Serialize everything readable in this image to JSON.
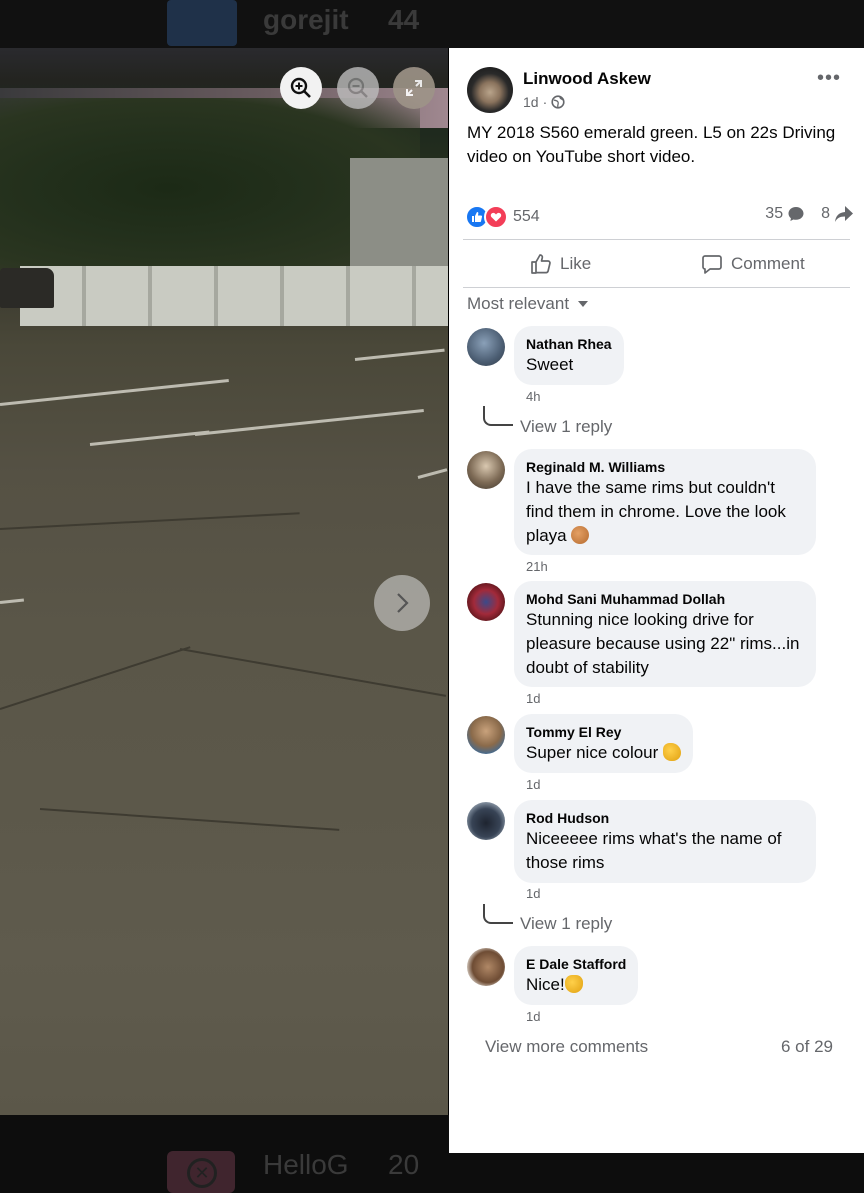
{
  "background": {
    "top_app": {
      "name": "gorejit",
      "count": "44"
    },
    "bottom_app": {
      "name": "HelloG",
      "count": "20"
    }
  },
  "viewer": {
    "icons": [
      "zoom-in-icon",
      "zoom-out-icon",
      "expand-icon",
      "chevron-right-icon"
    ]
  },
  "post": {
    "author": "Linwood Askew",
    "time": "1d",
    "audience_icon": "globe-icon",
    "text": "MY 2018 S560 emerald green. L5 on 22s Driving video on YouTube short video.",
    "reactions_count": "554",
    "comments_count": "35",
    "shares_count": "8",
    "like_label": "Like",
    "comment_label": "Comment",
    "sort_label": "Most relevant"
  },
  "comments": [
    {
      "name": "Nathan Rhea",
      "text": "Sweet",
      "time": "4h",
      "replies": "View 1 reply"
    },
    {
      "name": "Reginald M. Williams",
      "text_lines": [
        "I have the same rims but couldn't",
        "find them in chrome. Love the look",
        "playa"
      ],
      "time": "21h"
    },
    {
      "name": "Mohd Sani Muhammad Dollah",
      "text_lines": [
        "Stunning nice looking drive for",
        "pleasure because using 22\" rims...in",
        "doubt of stability"
      ],
      "time": "1d"
    },
    {
      "name": "Tommy El Rey",
      "text": "Super nice colour",
      "time": "1d"
    },
    {
      "name": "Rod Hudson",
      "text_lines": [
        "Niceeeee rims what's the name of",
        "those rims"
      ],
      "time": "1d",
      "replies": "View 1 reply"
    },
    {
      "name": "E Dale Stafford",
      "text": "Nice!",
      "time": "1d"
    }
  ],
  "footer": {
    "view_more": "View more comments",
    "page_count": "6 of 29"
  },
  "colors": {
    "like_blue": "#1877f2",
    "love_red": "#f33e58",
    "secondary_text": "#65676b",
    "bubble": "#f0f2f5"
  }
}
